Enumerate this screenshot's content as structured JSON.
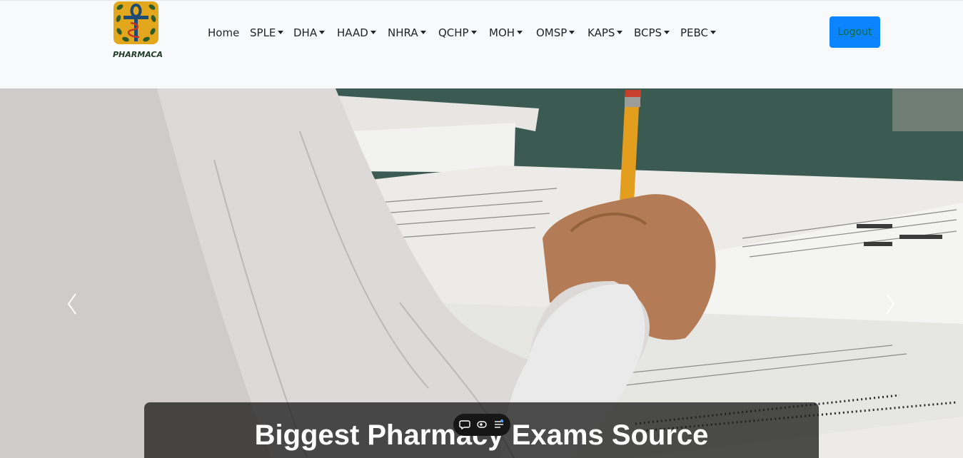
{
  "brand": {
    "logo_text": "PHARMACA"
  },
  "nav": {
    "items": [
      {
        "label": "Home",
        "dropdown": false
      },
      {
        "label": "SPLE",
        "dropdown": true
      },
      {
        "label": "DHA",
        "dropdown": true
      },
      {
        "label": "HAAD",
        "dropdown": true
      },
      {
        "label": "NHRA",
        "dropdown": true
      },
      {
        "label": "QCHP",
        "dropdown": true
      },
      {
        "label": "MOH",
        "dropdown": true
      },
      {
        "label": "OMSP",
        "dropdown": true
      },
      {
        "label": "KAPS",
        "dropdown": true
      },
      {
        "label": "BCPS",
        "dropdown": true
      },
      {
        "label": "PEBC",
        "dropdown": true
      }
    ]
  },
  "auth": {
    "logout_label": "Logout"
  },
  "hero": {
    "caption_title": "Biggest Pharmacy Exams Source",
    "prev_icon": "chevron-left-icon",
    "next_icon": "chevron-right-icon"
  },
  "toolbar": {
    "icons": [
      "chat-icon",
      "eye-icon",
      "settings-list-icon"
    ]
  },
  "colors": {
    "navbar_bg": "#f8f9fa",
    "logout_bg": "#0d84ff",
    "logout_text": "#0f6b3a",
    "logo_bg": "#e2a71c",
    "caption_bg": "#1e1e1e"
  }
}
